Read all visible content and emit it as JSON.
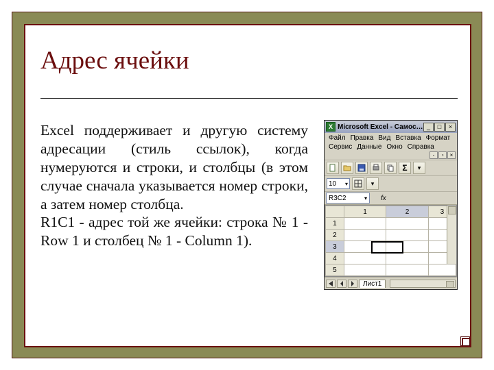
{
  "slide": {
    "title": "Адрес ячейки",
    "para1": "Excel  поддерживает и другую систему адресации (стиль ссылок), когда нумеруются и строки, и столбцы (в этом случае сначала указывается номер строки, а затем номер столбца.",
    "para2": "R1C1 - адрес той же ячейки: строка № 1 - Row 1 и столбец № 1 - Column 1)."
  },
  "excel": {
    "app_title": "Microsoft Excel - Самос…",
    "menu": [
      "Файл",
      "Правка",
      "Вид",
      "Вставка",
      "Формат",
      "Сервис",
      "Данные",
      "Окно",
      "Справка"
    ],
    "font_size": "10",
    "namebox": "R3C2",
    "fx_label": "fx",
    "col_headers": [
      "1",
      "2",
      "3"
    ],
    "row_headers": [
      "1",
      "2",
      "3",
      "4",
      "5"
    ],
    "active_cell": {
      "row": 3,
      "col": 2
    },
    "sheet_tab": "Лист1",
    "icons": {
      "new": "new-icon",
      "open": "open-icon",
      "save": "save-icon",
      "print": "print-icon",
      "copy": "copy-icon",
      "sum": "Σ"
    }
  }
}
